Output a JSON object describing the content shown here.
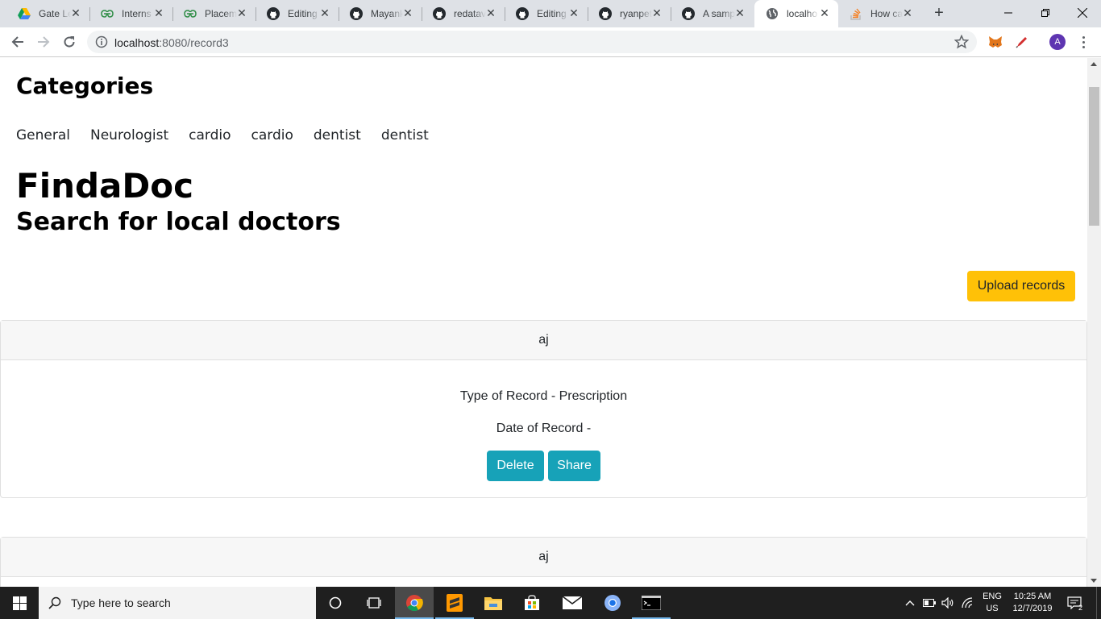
{
  "browser": {
    "tabs": [
      {
        "title": "Gate Le",
        "icon": "google-drive-icon",
        "active": false
      },
      {
        "title": "Interns",
        "icon": "geeksforgeeks-icon",
        "active": false
      },
      {
        "title": "Placem",
        "icon": "geeksforgeeks-icon",
        "active": false
      },
      {
        "title": "Editing",
        "icon": "github-icon",
        "active": false
      },
      {
        "title": "Mayank",
        "icon": "github-icon",
        "active": false
      },
      {
        "title": "redatav",
        "icon": "github-icon",
        "active": false
      },
      {
        "title": "Editing",
        "icon": "github-icon",
        "active": false
      },
      {
        "title": "ryanpet",
        "icon": "github-icon",
        "active": false
      },
      {
        "title": "A samp",
        "icon": "github-icon",
        "active": false
      },
      {
        "title": "localho",
        "icon": "globe-icon",
        "active": true
      },
      {
        "title": "How ca",
        "icon": "stackoverflow-icon",
        "active": false
      }
    ],
    "url_host": "localhost",
    "url_path": ":8080/record3",
    "profile_initial": "A"
  },
  "page": {
    "categories_title": "Categories",
    "categories": [
      "General",
      "Neurologist",
      "cardio",
      "cardio",
      "dentist",
      "dentist"
    ],
    "brand_title": "FindaDoc",
    "brand_subtitle": "Search for local doctors",
    "upload_label": "Upload records",
    "records": [
      {
        "name": "aj",
        "type_line": "Type of Record - Prescription",
        "date_line": "Date of Record -",
        "delete_label": "Delete",
        "share_label": "Share"
      },
      {
        "name": "aj"
      }
    ]
  },
  "taskbar": {
    "search_placeholder": "Type here to search",
    "language": "ENG",
    "region": "US",
    "time": "10:25 AM",
    "date": "12/7/2019",
    "notification_count": "2"
  },
  "colors": {
    "upload_button": "#ffc107",
    "action_button": "#17a2b8",
    "card_header_bg": "#f7f7f7"
  }
}
